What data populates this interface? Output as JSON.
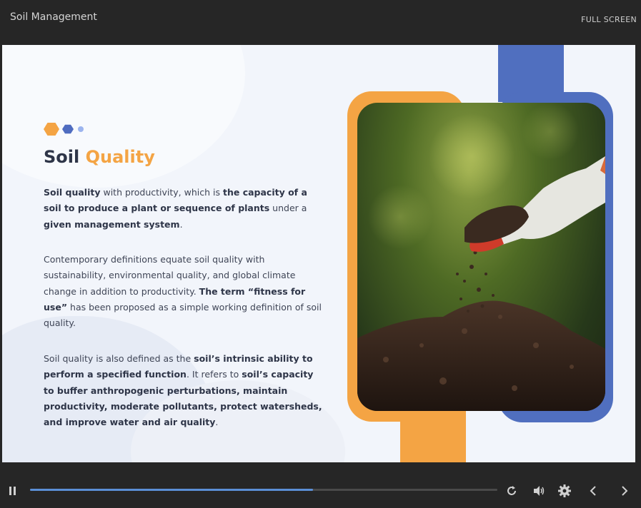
{
  "header": {
    "title": "Soil Management",
    "fullscreen_label": "FULL SCREEN"
  },
  "slide": {
    "title_main": "Soil",
    "title_accent": "Quality",
    "paragraphs": [
      {
        "segments": [
          {
            "text": "Soil quality",
            "bold": true
          },
          {
            "text": " with productivity, which is ",
            "bold": false
          },
          {
            "text": "the capacity of a soil to produce a plant or sequence of plants",
            "bold": true
          },
          {
            "text": " under a ",
            "bold": false
          },
          {
            "text": "given management system",
            "bold": true
          },
          {
            "text": ".",
            "bold": false
          }
        ]
      },
      {
        "segments": [
          {
            "text": "Contemporary definitions equate soil quality with sustainability, environmental quality, and global climate change in addition to productivity. ",
            "bold": false
          },
          {
            "text": "The term “fitness for use”",
            "bold": true
          },
          {
            "text": " has been proposed as a simple working definition of soil quality.",
            "bold": false
          }
        ]
      },
      {
        "segments": [
          {
            "text": "Soil quality is also defined as the ",
            "bold": false
          },
          {
            "text": "soil’s intrinsic ability to perform a specified function",
            "bold": true
          },
          {
            "text": ". It refers to ",
            "bold": false
          },
          {
            "text": "soil’s capacity to buffer anthropogenic perturbations, maintain productivity, moderate pollutants, protect watersheds, and improve water and air quality",
            "bold": true
          },
          {
            "text": ".",
            "bold": false
          }
        ]
      }
    ],
    "image_subject": "gloved-hand-pouring-soil-photo"
  },
  "colors": {
    "accent_orange": "#f4a444",
    "accent_blue": "#506fbf",
    "progress": "#5b8fd6"
  },
  "player": {
    "progress_fraction": 0.605,
    "controls": [
      "pause-icon",
      "replay-icon",
      "volume-icon",
      "settings-icon",
      "chevron-left-icon",
      "chevron-right-icon"
    ]
  }
}
